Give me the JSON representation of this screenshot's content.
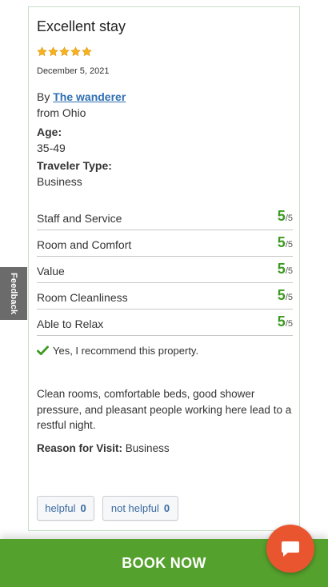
{
  "review": {
    "title": "Excellent stay",
    "stars": 5,
    "date": "December 5, 2021",
    "by_prefix": "By",
    "author": "The wanderer",
    "from": "from Ohio",
    "age_label": "Age:",
    "age_value": "35-49",
    "traveler_type_label": "Traveler Type:",
    "traveler_type_value": "Business",
    "ratings": [
      {
        "label": "Staff and Service",
        "score": "5",
        "max": "/5"
      },
      {
        "label": "Room and Comfort",
        "score": "5",
        "max": "/5"
      },
      {
        "label": "Value",
        "score": "5",
        "max": "/5"
      },
      {
        "label": "Room Cleanliness",
        "score": "5",
        "max": "/5"
      },
      {
        "label": "Able to Relax",
        "score": "5",
        "max": "/5"
      }
    ],
    "recommend_text": "Yes, I recommend this property.",
    "body": "Clean rooms, comfortable beds, good shower pressure, and pleasant people working here lead to a restful night.",
    "reason_label": "Reason for Visit:",
    "reason_value": "Business",
    "helpful_label": "helpful",
    "helpful_count": "0",
    "not_helpful_label": "not helpful",
    "not_helpful_count": "0"
  },
  "feedback_tab": "Feedback",
  "book_now": "BOOK NOW",
  "colors": {
    "star": "#f5b21b",
    "score_green": "#3b9a1f",
    "book_bar": "#55a12d",
    "chat_button": "#e8552f",
    "link": "#2f6fb3"
  },
  "icons": {
    "rating_star": "star-icon",
    "recommend": "checkmark-icon",
    "chat": "chat-bubble-icon"
  }
}
